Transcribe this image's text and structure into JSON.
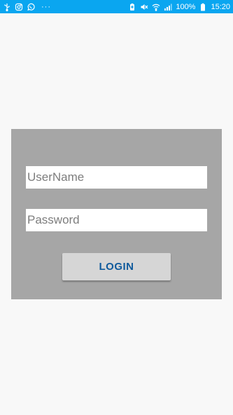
{
  "status_bar": {
    "background_color": "#0aa6f0",
    "left_icons": [
      "usb-debug-icon",
      "instagram-icon",
      "whatsapp-icon"
    ],
    "more_indicator": "···",
    "right_icons": [
      "battery-saver-icon",
      "mute-icon",
      "wifi-icon",
      "signal-icon",
      "battery-icon"
    ],
    "battery_percent": "100%",
    "time": "15:20"
  },
  "login_form": {
    "card_color": "#a6a6a6",
    "username": {
      "placeholder": "UserName",
      "value": ""
    },
    "password": {
      "placeholder": "Password",
      "value": ""
    },
    "login_button": {
      "label": "LOGIN",
      "text_color": "#0f5a9c"
    }
  }
}
